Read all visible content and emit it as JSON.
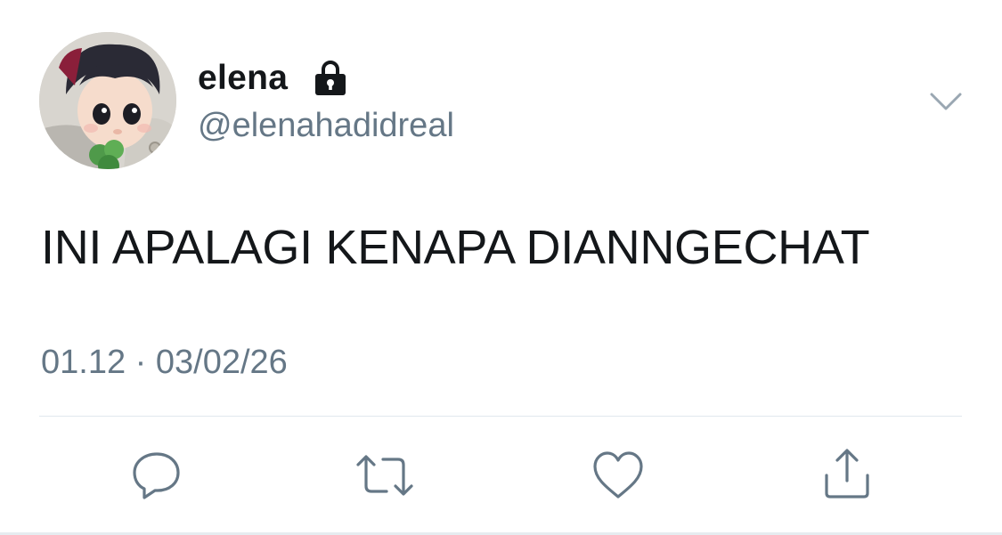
{
  "tweet": {
    "author": {
      "display_name": "elena",
      "handle": "@elenahadidreal",
      "protected_icon": "lock-icon"
    },
    "text": "INI APALAGI KENAPA DIANNGECHAT",
    "timestamp": "01.12 · 03/02/26",
    "menu_icon": "chevron-down-icon",
    "actions": [
      {
        "name": "reply",
        "icon": "reply-icon"
      },
      {
        "name": "retweet",
        "icon": "retweet-icon"
      },
      {
        "name": "like",
        "icon": "heart-icon"
      },
      {
        "name": "share",
        "icon": "share-icon"
      }
    ]
  },
  "colors": {
    "text_primary": "#14171a",
    "text_secondary": "#657786",
    "icon": "#657786",
    "divider": "#e1e8ed"
  }
}
